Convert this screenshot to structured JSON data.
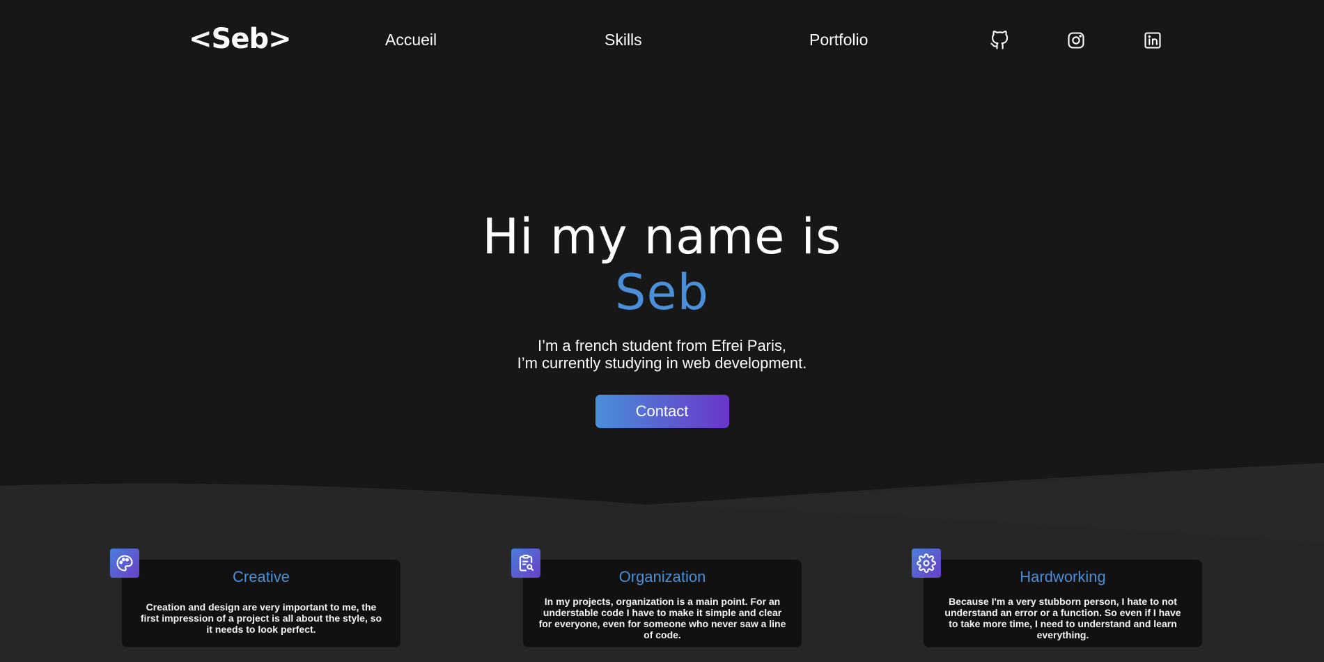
{
  "nav": {
    "logo": "<Seb>",
    "links": [
      "Accueil",
      "Skills",
      "Portfolio"
    ],
    "social_icons": [
      "github-icon",
      "instagram-icon",
      "linkedin-icon"
    ]
  },
  "hero": {
    "greeting": "Hi my name is",
    "name": "Seb",
    "subtitle_line1": "I’m a french student from Efrei Paris,",
    "subtitle_line2": "I’m currently studying in web development.",
    "contact_label": "Contact"
  },
  "features": [
    {
      "icon": "palette-icon",
      "title": "Creative",
      "text": "Creation and design are very important to me, the first impression of a project is all about the style, so it needs to look perfect."
    },
    {
      "icon": "clipboard-search-icon",
      "title": "Organization",
      "text": "In my projects, organization is a main point. For an understable code I have to make it simple and clear for everyone, even for someone who never saw a line of code."
    },
    {
      "icon": "gear-icon",
      "title": "Hardworking",
      "text": "Because I'm a very stubborn person, I hate to not understand an error or a function. So even if I have to take more time, I need to understand and learn everything."
    }
  ],
  "colors": {
    "background": "#171717",
    "section_background": "#262626",
    "accent_blue": "#4a8fd8",
    "gradient_start": "#4a90d9",
    "gradient_end": "#6a36c9",
    "card_background": "#111111"
  }
}
